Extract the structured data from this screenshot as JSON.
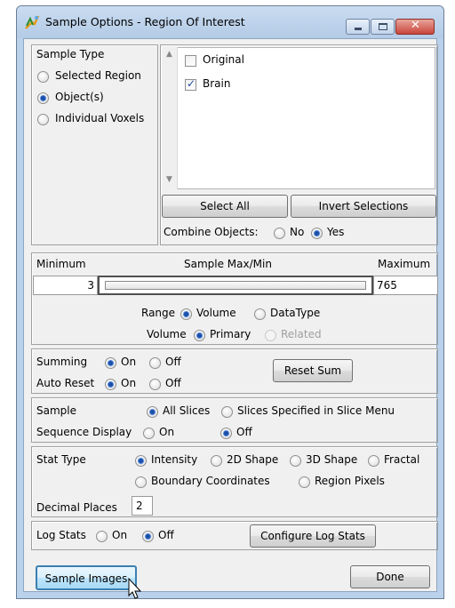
{
  "window": {
    "title": "Sample Options - Region Of Interest",
    "buttons": [
      "minimize-icon",
      "maximize-icon",
      "close-icon"
    ],
    "close_color": "#c9453b"
  },
  "sample_type": {
    "heading": "Sample Type",
    "options": [
      {
        "label": "Selected Region",
        "selected": false
      },
      {
        "label": "Object(s)",
        "selected": true
      },
      {
        "label": "Individual Voxels",
        "selected": false
      }
    ]
  },
  "objects": {
    "items": [
      {
        "label": "Original",
        "checked": false
      },
      {
        "label": "Brain",
        "checked": true
      }
    ],
    "select_all": "Select All",
    "invert": "Invert Selections",
    "combine_label": "Combine Objects:",
    "no_label": "No",
    "yes_label": "Yes",
    "combine_value": "Yes"
  },
  "range": {
    "min_label": "Minimum",
    "center_label": "Sample Max/Min",
    "max_label": "Maximum",
    "min_value": "3",
    "max_value": "765",
    "range_label": "Range",
    "volume_label": "Volume",
    "datatype_label": "DataType",
    "range_value": "Volume",
    "volume_row_label": "Volume",
    "primary_label": "Primary",
    "related_label": "Related",
    "volume_value": "Primary"
  },
  "summing": {
    "summing_label": "Summing",
    "on_label": "On",
    "off_label": "Off",
    "summing_value": "On",
    "auto_reset_label": "Auto Reset",
    "auto_reset_value": "On",
    "reset_button": "Reset Sum"
  },
  "sample": {
    "sample_label": "Sample",
    "all_slices": "All Slices",
    "slices_specified": "Slices Specified in Slice Menu",
    "sample_value": "All Slices",
    "sequence_label": "Sequence Display",
    "on_label": "On",
    "off_label": "Off",
    "sequence_value": "Off"
  },
  "stat": {
    "stat_type_label": "Stat Type",
    "options": [
      "Intensity",
      "2D Shape",
      "3D Shape",
      "Fractal",
      "Boundary Coordinates",
      "Region Pixels"
    ],
    "selected": "Intensity",
    "decimal_label": "Decimal Places",
    "decimal_value": "2"
  },
  "log": {
    "log_label": "Log Stats",
    "on_label": "On",
    "off_label": "Off",
    "value": "Off",
    "configure_button": "Configure Log Stats"
  },
  "footer": {
    "sample_images": "Sample Images",
    "done": "Done"
  }
}
